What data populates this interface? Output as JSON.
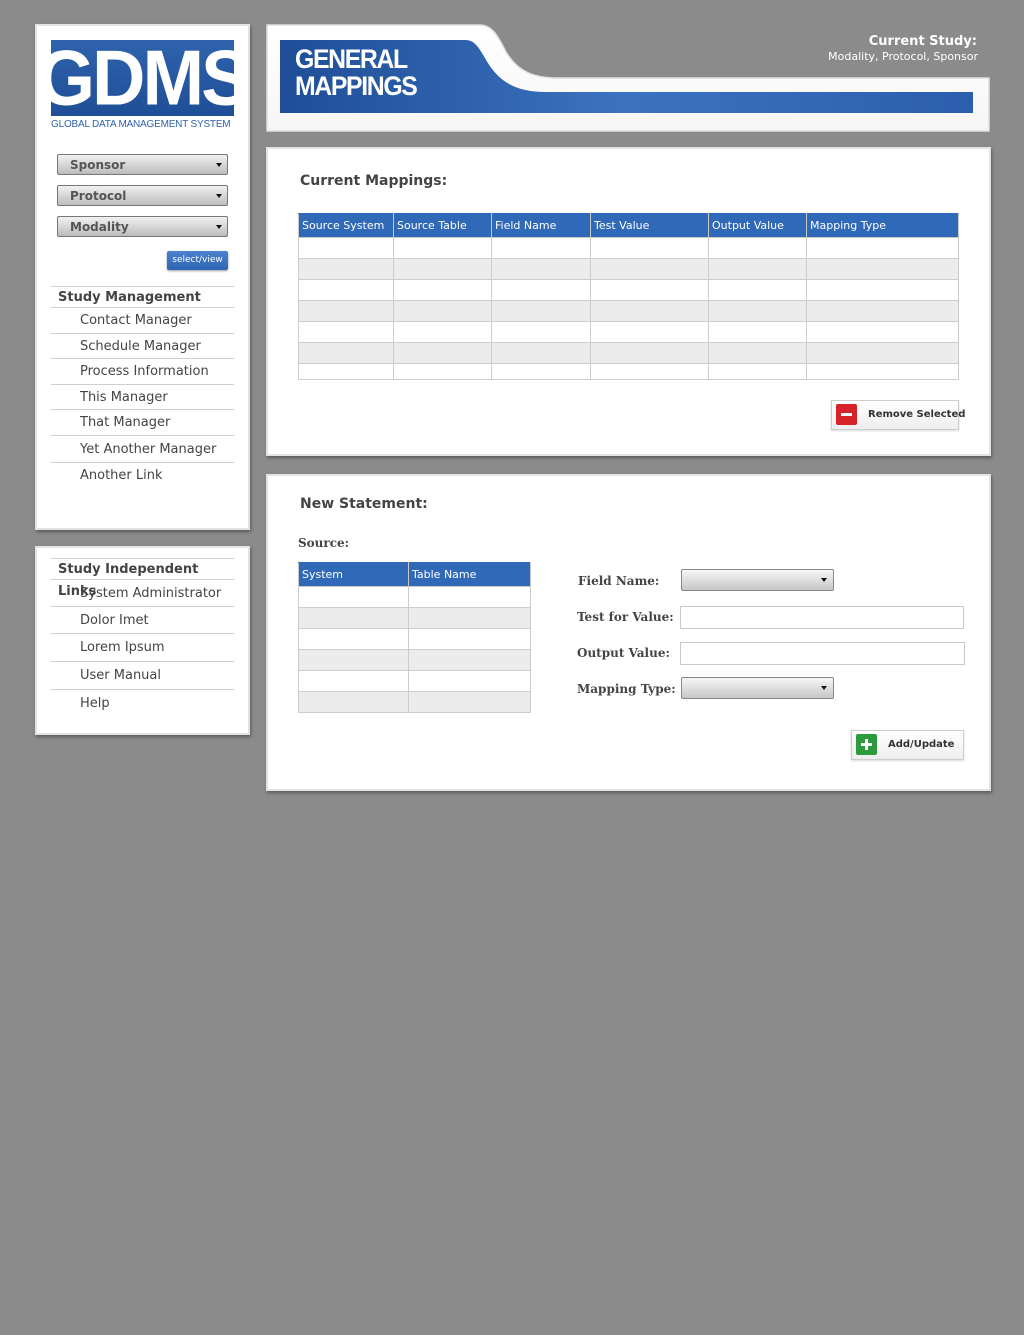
{
  "logo": {
    "text": "GDMS",
    "subtitle": "GLOBAL DATA MANAGEMENT SYSTEM"
  },
  "filters": {
    "sponsor": "Sponsor",
    "protocol": "Protocol",
    "modality": "Modality",
    "select_view_label": "select/view"
  },
  "study_management": {
    "heading": "Study Management",
    "items": [
      "Contact Manager",
      "Schedule Manager",
      "Process Information",
      "This Manager",
      "That Manager",
      "Yet Another Manager",
      "Another Link"
    ]
  },
  "independent_links": {
    "heading": "Study Independent Links",
    "items": [
      "System Administrator",
      "Dolor Imet",
      "Lorem Ipsum",
      "User Manual",
      "Help"
    ]
  },
  "header": {
    "title_line1": "GENERAL",
    "title_line2": "MAPPINGS",
    "current_study_label": "Current Study:",
    "current_study_value": "Modality, Protocol, Sponsor",
    "colors": {
      "brand_blue": "#2f63ad"
    }
  },
  "current_mappings": {
    "title": "Current Mappings:",
    "columns": [
      "Source System",
      "Source Table",
      "Field Name",
      "Test Value",
      "Output Value",
      "Mapping Type"
    ],
    "remove_label": "Remove Selected"
  },
  "new_statement": {
    "title": "New Statement:",
    "source_label": "Source:",
    "source_columns": [
      "System",
      "Table Name"
    ],
    "field_name_label": "Field Name:",
    "test_value_label": "Test for Value:",
    "output_value_label": "Output Value:",
    "mapping_type_label": "Mapping Type:",
    "add_label": "Add/Update"
  }
}
